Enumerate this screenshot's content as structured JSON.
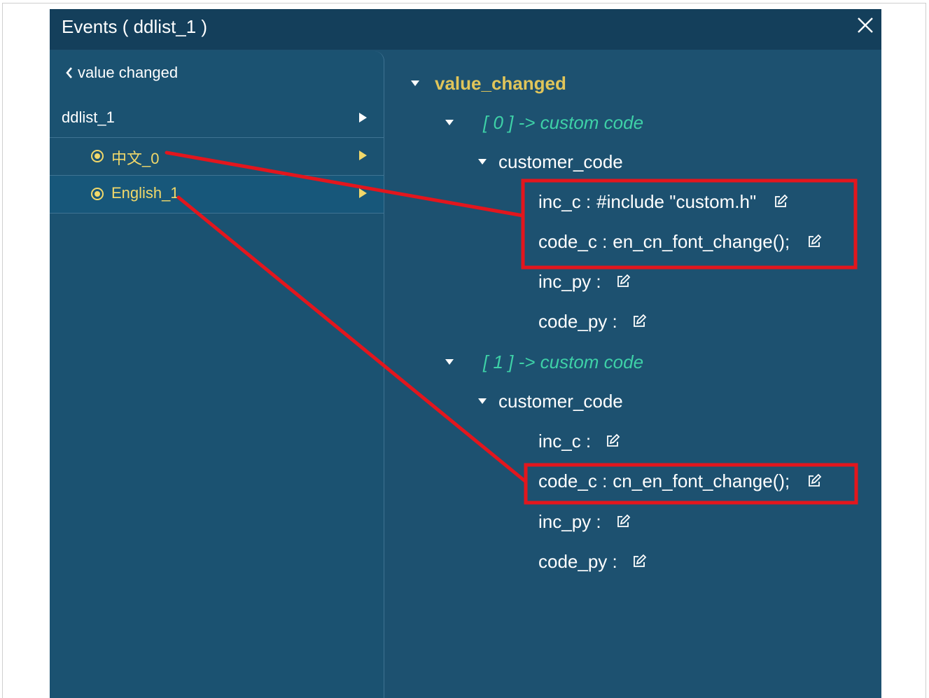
{
  "window": {
    "title": "Events ( ddlist_1 )",
    "close_icon": "close-icon"
  },
  "left": {
    "back_label": "value changed",
    "root_label": "ddlist_1",
    "options": [
      {
        "label": "中文_0",
        "selected": false
      },
      {
        "label": "English_1",
        "selected": true
      }
    ]
  },
  "tree": {
    "event": "value_changed",
    "actions": [
      {
        "header": "[ 0 ] -> custom code",
        "node": "customer_code",
        "fields": [
          {
            "label": "inc_c :",
            "value": "#include \"custom.h\""
          },
          {
            "label": "code_c :",
            "value": "en_cn_font_change();"
          },
          {
            "label": "inc_py :",
            "value": ""
          },
          {
            "label": "code_py :",
            "value": ""
          }
        ]
      },
      {
        "header": "[ 1 ] -> custom code",
        "node": "customer_code",
        "fields": [
          {
            "label": "inc_c :",
            "value": ""
          },
          {
            "label": "code_c :",
            "value": "cn_en_font_change();"
          },
          {
            "label": "inc_py :",
            "value": ""
          },
          {
            "label": "code_py :",
            "value": ""
          }
        ]
      }
    ]
  },
  "colors": {
    "panel_bg": "#1d5170",
    "title_bg": "#143f5b",
    "event_label": "#e0c55a",
    "action_label": "#3ed1a7",
    "option_text": "#f1d86a",
    "annotation_red": "#e3161d"
  }
}
